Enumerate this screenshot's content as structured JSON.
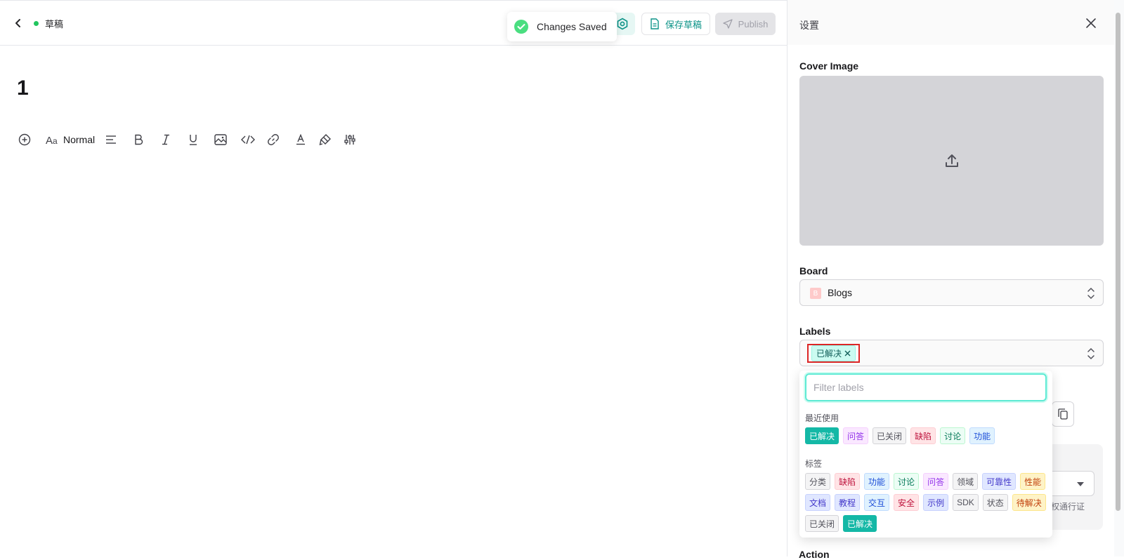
{
  "editor": {
    "status": "草稿",
    "title": "1",
    "toolbar": {
      "text_style": "Normal"
    },
    "buttons": {
      "save_draft": "保存草稿",
      "publish": "Publish"
    },
    "toast": "Changes Saved"
  },
  "panel": {
    "title": "设置",
    "cover_label": "Cover Image",
    "board_label": "Board",
    "board": {
      "badge": "B",
      "name": "Blogs"
    },
    "labels_label": "Labels",
    "selected_label": "已解决",
    "action_label": "Action",
    "partial_text": "权通行证"
  },
  "dropdown": {
    "placeholder": "Filter labels",
    "recent_header": "最近使用",
    "recent": [
      {
        "text": "已解决",
        "color": "teal-solid"
      },
      {
        "text": "问答",
        "color": "purple"
      },
      {
        "text": "已关闭",
        "color": "gray"
      },
      {
        "text": "缺陷",
        "color": "red"
      },
      {
        "text": "讨论",
        "color": "green"
      },
      {
        "text": "功能",
        "color": "blue"
      }
    ],
    "tags_header": "标签",
    "tags_row1": [
      {
        "text": "分类",
        "color": "gray"
      },
      {
        "text": "缺陷",
        "color": "red"
      },
      {
        "text": "功能",
        "color": "blue"
      },
      {
        "text": "讨论",
        "color": "green"
      },
      {
        "text": "问答",
        "color": "purple"
      },
      {
        "text": "领域",
        "color": "gray"
      },
      {
        "text": "可靠性",
        "color": "indigo"
      },
      {
        "text": "性能",
        "color": "orange"
      }
    ],
    "tags_row2": [
      {
        "text": "文档",
        "color": "indigo"
      },
      {
        "text": "教程",
        "color": "indigo"
      },
      {
        "text": "交互",
        "color": "blue"
      },
      {
        "text": "安全",
        "color": "red"
      },
      {
        "text": "示例",
        "color": "indigo"
      },
      {
        "text": "SDK",
        "color": "gray"
      },
      {
        "text": "状态",
        "color": "gray"
      },
      {
        "text": "待解决",
        "color": "orange"
      }
    ],
    "tags_row3": [
      {
        "text": "已关闭",
        "color": "gray"
      },
      {
        "text": "已解决",
        "color": "teal-solid"
      }
    ]
  }
}
